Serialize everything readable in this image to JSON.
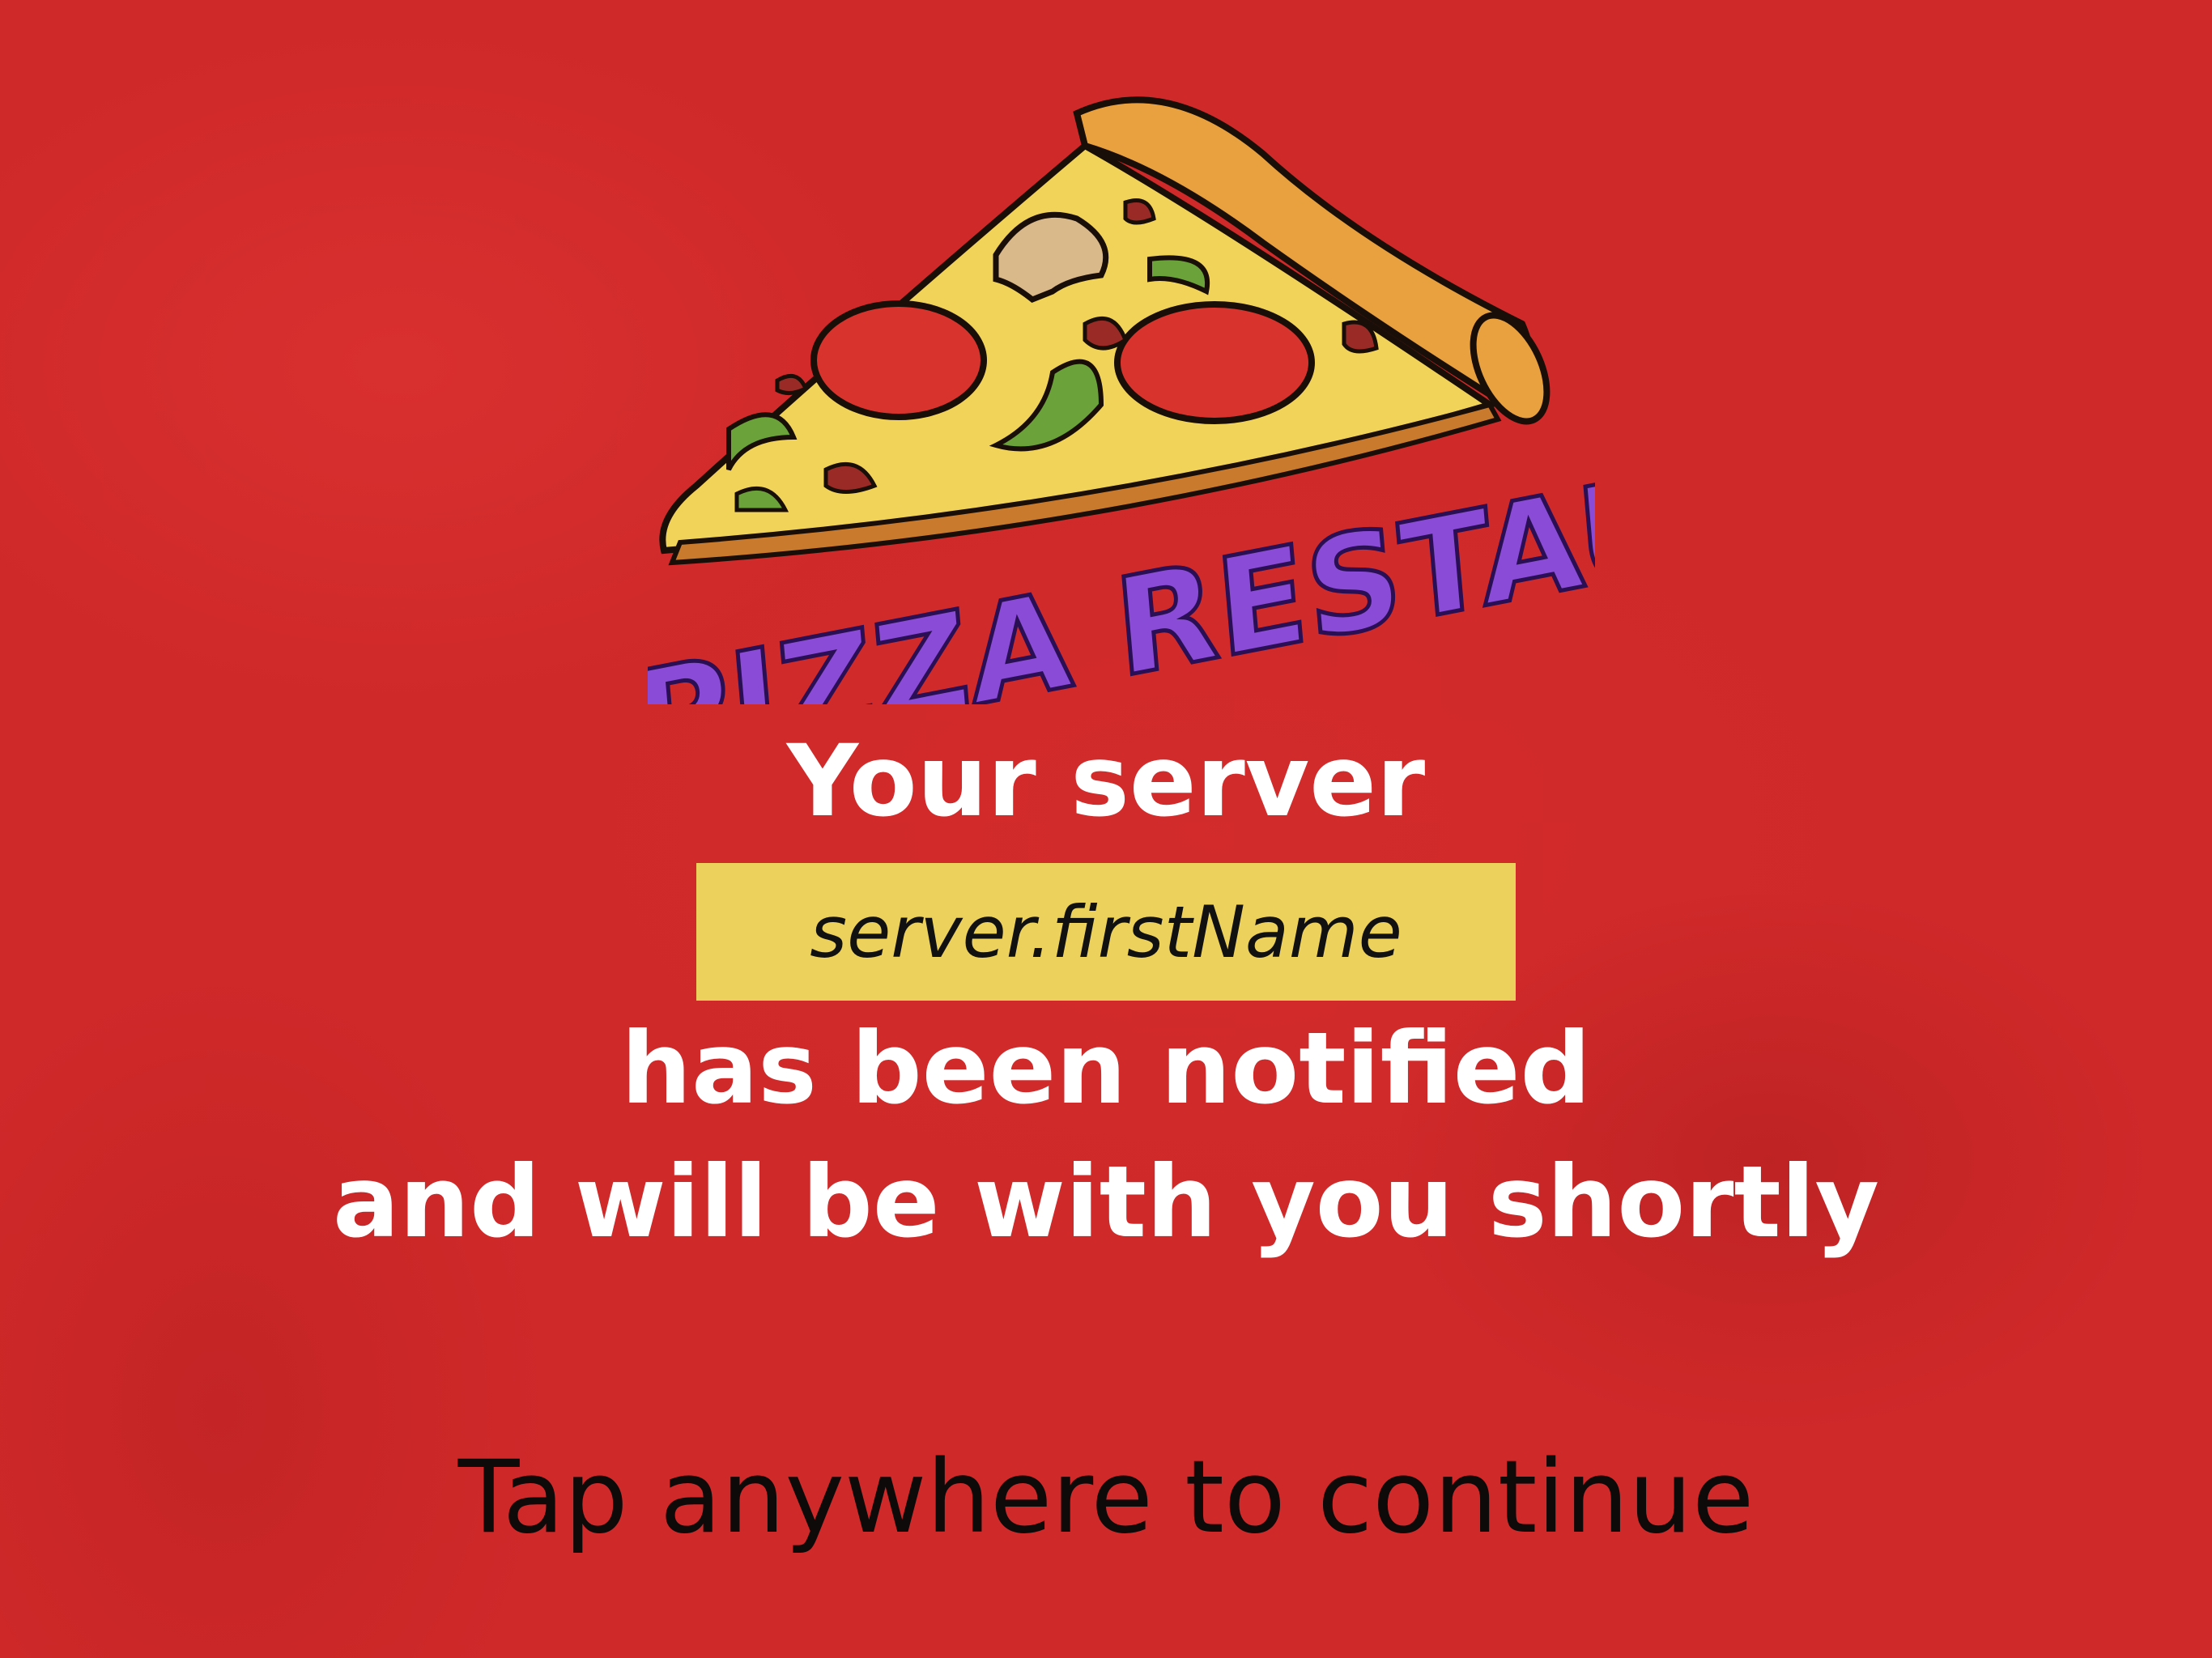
{
  "logo": {
    "text": "PIZZA RESTAURANT",
    "icon": "pizza-slice-icon"
  },
  "message": {
    "line1": "Your server",
    "server_name": "server.firstName",
    "line2": "has been notified",
    "line3": "and will be with you shortly"
  },
  "prompt": {
    "tap_label": "Tap anywhere to continue"
  },
  "colors": {
    "background": "#d0292a",
    "name_box": "#ecd15c",
    "logo_text": "#8a4bd6",
    "message_text": "#ffffff",
    "prompt_text": "#0e0a0a"
  }
}
